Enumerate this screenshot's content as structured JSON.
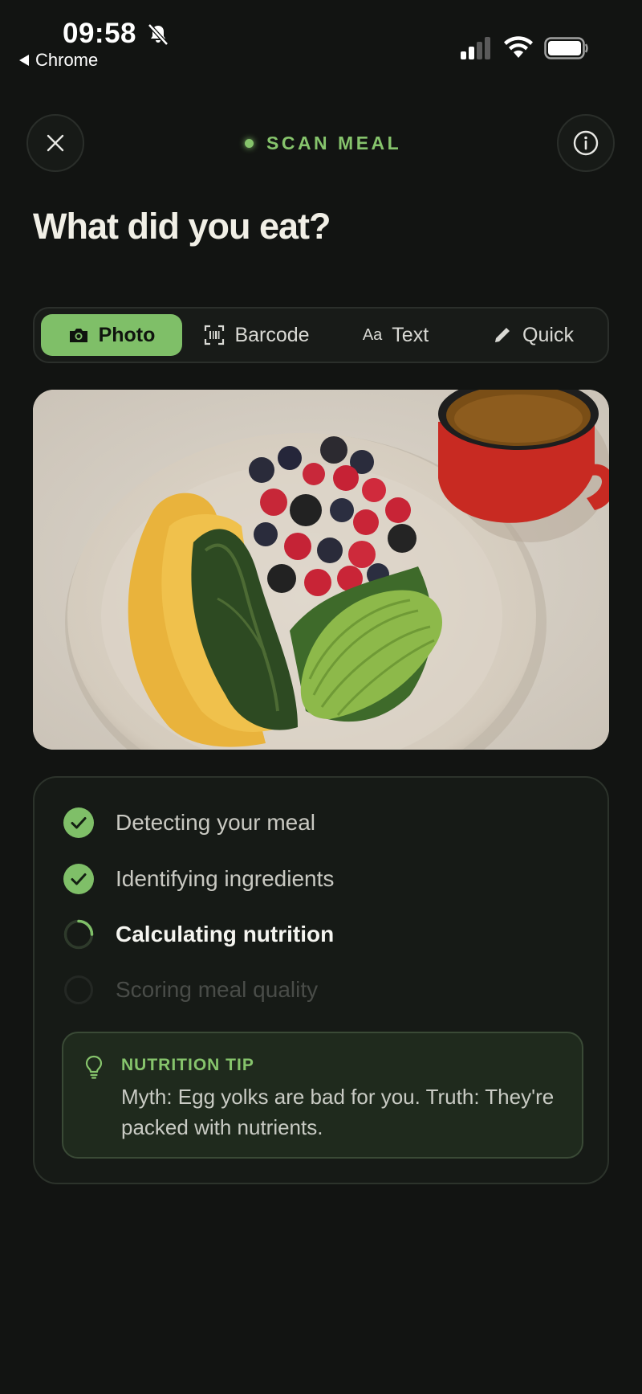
{
  "status_bar": {
    "time": "09:58",
    "back_app": "Chrome",
    "icons": [
      "bell-off-icon",
      "cellular-signal-icon",
      "wifi-icon",
      "battery-icon"
    ]
  },
  "header": {
    "label": "SCAN MEAL",
    "close_icon": "close-icon",
    "info_icon": "info-icon",
    "accent_color": "#86c46c"
  },
  "title": "What did you eat?",
  "tabs": [
    {
      "label": "Photo",
      "icon": "camera-icon",
      "selected": true
    },
    {
      "label": "Barcode",
      "icon": "barcode-scan-icon",
      "selected": false
    },
    {
      "label": "Text",
      "icon": "text-aa-icon",
      "selected": false
    },
    {
      "label": "Quick",
      "icon": "pencil-icon",
      "selected": false
    }
  ],
  "photo": {
    "alt": ""
  },
  "progress": {
    "steps": [
      {
        "label": "Detecting your meal",
        "state": "done"
      },
      {
        "label": "Identifying ingredients",
        "state": "done"
      },
      {
        "label": "Calculating nutrition",
        "state": "in-progress"
      },
      {
        "label": "Scoring meal quality",
        "state": "pending"
      }
    ]
  },
  "tip": {
    "title": "NUTRITION TIP",
    "body": "Myth: Egg yolks are bad for you. Truth: They're packed with nutrients.",
    "icon": "lightbulb-icon"
  }
}
